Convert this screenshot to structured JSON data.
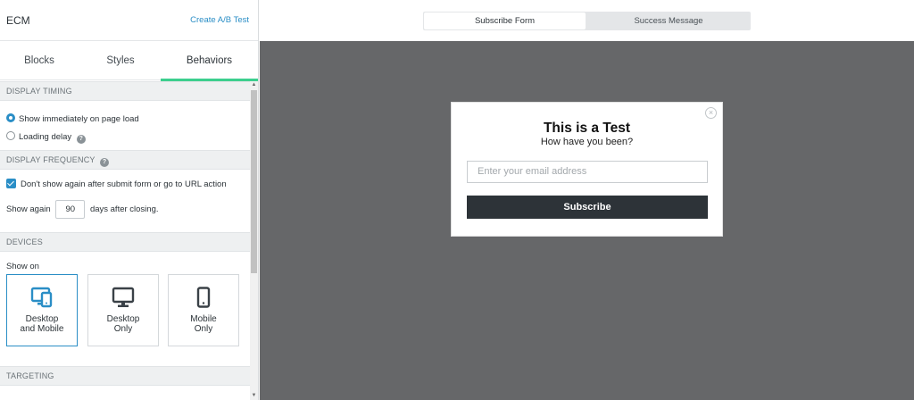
{
  "header": {
    "app_title": "ECM",
    "ab_test_link": "Create A/B Test"
  },
  "tabs": [
    {
      "label": "Blocks"
    },
    {
      "label": "Styles"
    },
    {
      "label": "Behaviors",
      "active": true
    }
  ],
  "display_timing": {
    "heading": "DISPLAY TIMING",
    "options": [
      {
        "label": "Show immediately on page load",
        "selected": true
      },
      {
        "label": "Loading delay",
        "selected": false
      }
    ]
  },
  "display_frequency": {
    "heading": "DISPLAY FREQUENCY",
    "checkbox_label": "Don't show again after submit form or go to URL action",
    "checked": true,
    "show_again_prefix": "Show again",
    "show_again_days": "90",
    "show_again_suffix": "days after closing."
  },
  "devices": {
    "heading": "DEVICES",
    "show_on_label": "Show on",
    "options": [
      {
        "line1": "Desktop",
        "line2": "and Mobile",
        "icon": "desktop-mobile-icon",
        "selected": true
      },
      {
        "line1": "Desktop",
        "line2": "Only",
        "icon": "desktop-icon",
        "selected": false
      },
      {
        "line1": "Mobile",
        "line2": "Only",
        "icon": "mobile-icon",
        "selected": false
      }
    ]
  },
  "targeting": {
    "heading": "TARGETING"
  },
  "preview": {
    "segments": [
      {
        "label": "Subscribe Form",
        "active": true
      },
      {
        "label": "Success Message",
        "active": false
      }
    ],
    "modal": {
      "title": "This is a Test",
      "subtitle": "How have you been?",
      "email_placeholder": "Enter your email address",
      "button_label": "Subscribe"
    }
  },
  "colors": {
    "accent": "#2a8ec6",
    "tab_underline": "#3ccf8e",
    "canvas": "#666769",
    "button": "#2d3338"
  }
}
